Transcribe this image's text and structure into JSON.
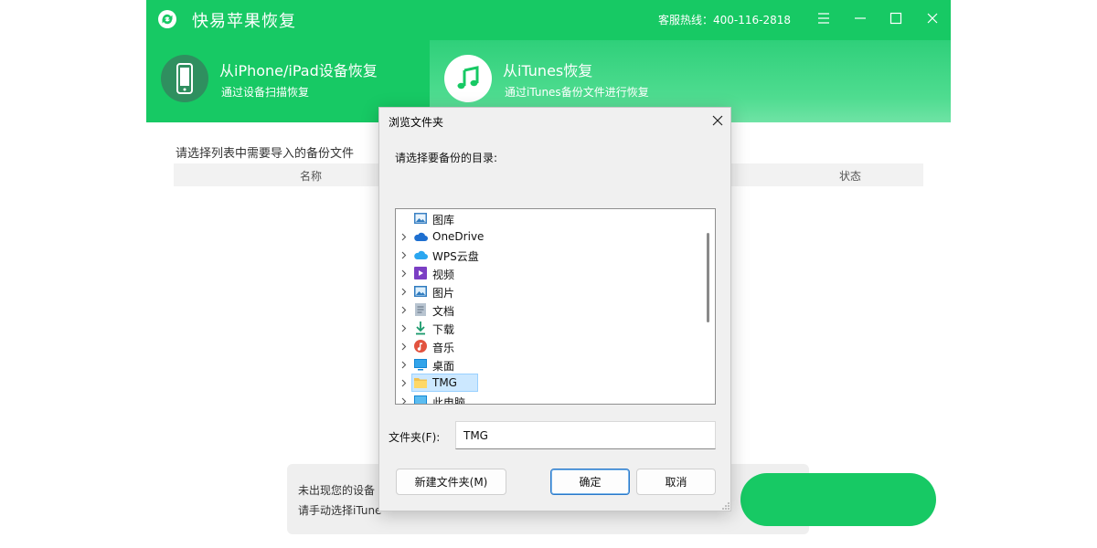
{
  "app": {
    "title": "快易苹果恢复",
    "hotline": "客服热线：400-116-2818",
    "colors": {
      "brand_green": "#17c964",
      "dialog_bg": "#f0f0f0",
      "selection": "#cce8ff"
    }
  },
  "tabs": [
    {
      "title": "从iPhone/iPad设备恢复",
      "subtitle": "通过设备扫描恢复",
      "icon": "phone-icon",
      "active": false
    },
    {
      "title": "从iTunes恢复",
      "subtitle": "通过iTunes备份文件进行恢复",
      "icon": "music-note-icon",
      "active": true
    }
  ],
  "main": {
    "list_label": "请选择列表中需要导入的备份文件",
    "columns": {
      "name": "名称",
      "status": "状态"
    },
    "hint_line1": "未出现您的设备",
    "hint_line2": "请手动选择iTune"
  },
  "dialog": {
    "title": "浏览文件夹",
    "prompt": "请选择要备份的目录:",
    "tree_items": [
      {
        "label": "图库",
        "icon": "gallery-icon",
        "expandable": false,
        "selected": false
      },
      {
        "label": "OneDrive",
        "icon": "cloud-icon",
        "expandable": true,
        "selected": false
      },
      {
        "label": "WPS云盘",
        "icon": "wps-cloud-icon",
        "expandable": true,
        "selected": false
      },
      {
        "label": "视频",
        "icon": "video-icon",
        "expandable": true,
        "selected": false
      },
      {
        "label": "图片",
        "icon": "picture-icon",
        "expandable": true,
        "selected": false
      },
      {
        "label": "文档",
        "icon": "document-icon",
        "expandable": true,
        "selected": false
      },
      {
        "label": "下载",
        "icon": "download-icon",
        "expandable": true,
        "selected": false
      },
      {
        "label": "音乐",
        "icon": "music-icon",
        "expandable": true,
        "selected": false
      },
      {
        "label": "桌面",
        "icon": "desktop-icon",
        "expandable": true,
        "selected": false
      },
      {
        "label": "TMG",
        "icon": "folder-icon",
        "expandable": true,
        "selected": true
      },
      {
        "label": "此电脑",
        "icon": "computer-icon",
        "expandable": true,
        "selected": false
      }
    ],
    "folder_label": "文件夹(F):",
    "folder_value": "TMG",
    "new_folder_label": "新建文件夹(M)",
    "ok_label": "确定",
    "cancel_label": "取消"
  }
}
